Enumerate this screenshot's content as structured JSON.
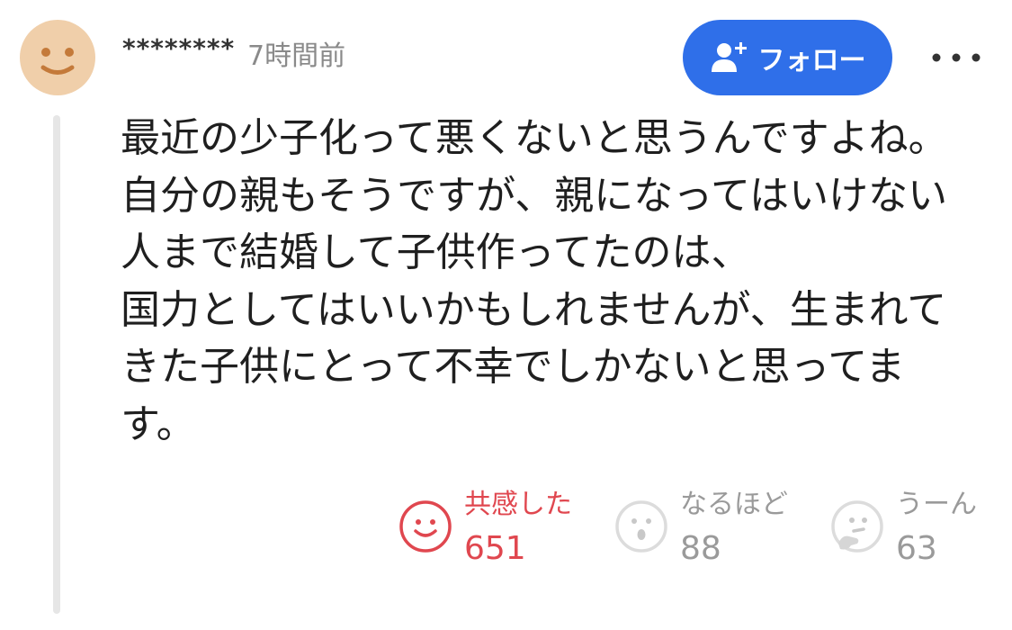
{
  "header": {
    "username": "********",
    "timestamp": "7時間前",
    "follow_label": "フォロー"
  },
  "icons": {
    "avatar": "smiley-avatar-icon",
    "follow": "user-plus-icon",
    "more": "more-horizontal-icon"
  },
  "colors": {
    "follow_button": "#2f6fe9",
    "avatar_bg": "#f0cfaa",
    "active_reaction": "#e0474f",
    "inactive_reaction": "#9a9a9a"
  },
  "comment": {
    "lines": [
      "最近の少子化って悪くないと思うんですよね。",
      "自分の親もそうですが、親になってはいけない",
      "人まで結婚して子供作ってたのは、",
      "国力としてはいいかもしれませんが、生まれて",
      "きた子供にとって不幸でしかないと思ってま",
      "す。"
    ]
  },
  "reactions": [
    {
      "label": "共感した",
      "count": "651",
      "icon": "smile-icon",
      "active": true
    },
    {
      "label": "なるほど",
      "count": "88",
      "icon": "surprised-icon",
      "active": false
    },
    {
      "label": "うーん",
      "count": "63",
      "icon": "thinking-icon",
      "active": false
    }
  ]
}
